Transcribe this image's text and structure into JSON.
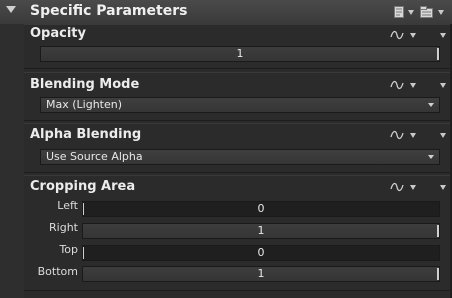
{
  "header": {
    "title": "Specific Parameters",
    "icons": [
      "page-icon",
      "dropdown-caret-icon",
      "folder-icon",
      "dropdown-caret-icon"
    ]
  },
  "sections": {
    "opacity": {
      "title": "Opacity",
      "value": "1"
    },
    "blending_mode": {
      "title": "Blending Mode",
      "selected": "Max (Lighten)"
    },
    "alpha_blending": {
      "title": "Alpha Blending",
      "selected": "Use Source Alpha"
    },
    "cropping_area": {
      "title": "Cropping Area",
      "fields": [
        {
          "label": "Left",
          "value": "0"
        },
        {
          "label": "Right",
          "value": "1"
        },
        {
          "label": "Top",
          "value": "0"
        },
        {
          "label": "Bottom",
          "value": "1"
        }
      ]
    }
  },
  "icons": {
    "section_link": "link-curve-icon",
    "section_menu": "menu-caret-icon"
  },
  "colors": {
    "background": "#2b2b2b",
    "header": "#3f3f3f",
    "field": "#383838",
    "field_dark": "#1f1f1f",
    "text": "#e6e6e6"
  }
}
